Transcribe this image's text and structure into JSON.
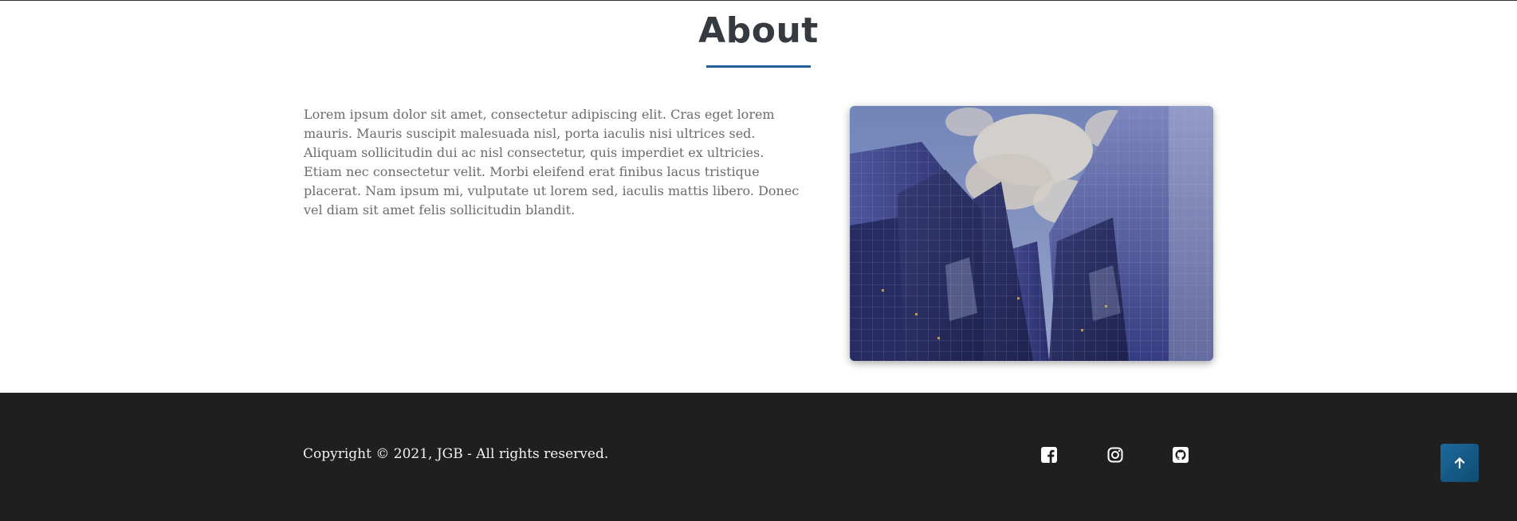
{
  "about": {
    "title": "About",
    "paragraph": "Lorem ipsum dolor sit amet, consectetur adipiscing elit. Cras eget lorem mauris. Mauris suscipit malesuada nisl, porta iaculis nisi ultrices sed. Aliquam sollicitudin dui ac nisl consectetur, quis imperdiet ex ultricies. Etiam nec consectetur velit. Morbi eleifend erat finibus lacus tristique placerat. Nam ipsum mi, vulputate ut lorem sed, iaculis mattis libero. Donec vel diam sit amet felis sollicitudin blandit.",
    "image_subject": "glass-skyscrapers-photo"
  },
  "footer": {
    "copyright": "Copyright © 2021, JGB - All rights reserved.",
    "social_icons": [
      "facebook-icon",
      "instagram-icon",
      "github-icon"
    ],
    "back_to_top_icon": "arrow-up-icon"
  },
  "colors": {
    "accent": "#1d5f96",
    "title": "#343a40",
    "body_text": "#6c6c6c",
    "footer_bg": "#1f1f1f",
    "footer_text": "#f2f2f2"
  }
}
